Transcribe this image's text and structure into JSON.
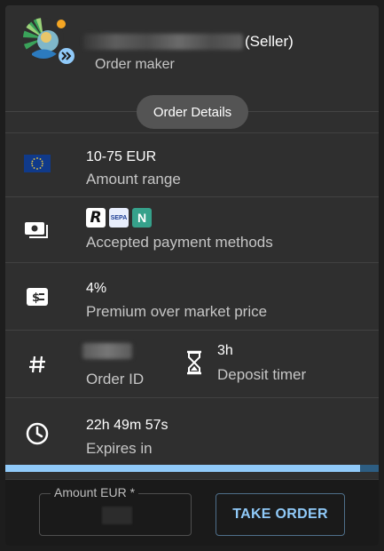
{
  "maker": {
    "seller_tag": "(Seller)",
    "role_label": "Order maker"
  },
  "section_chip": "Order Details",
  "amount": {
    "value": "10-75 EUR",
    "label": "Amount range"
  },
  "payment": {
    "label": "Accepted payment methods",
    "methods": [
      "R",
      "SEPA",
      "N"
    ]
  },
  "premium": {
    "value": "4%",
    "label": "Premium over market price"
  },
  "order_id": {
    "label": "Order ID"
  },
  "deposit": {
    "value": "3h",
    "label": "Deposit timer"
  },
  "expires": {
    "value": "22h 49m 57s",
    "label": "Expires in"
  },
  "progress_fraction": 0.95,
  "footer": {
    "amount_label": "Amount EUR *",
    "take_order_label": "TAKE ORDER"
  },
  "colors": {
    "accent": "#90caf9",
    "online": "#f5a623",
    "panel": "#2f2f2f"
  },
  "icons": {
    "amount": "eu-flag-icon",
    "payment": "cash-icon",
    "premium": "price-tag-icon",
    "order_id": "hash-icon",
    "deposit": "hourglass-icon",
    "expires": "clock-icon",
    "seller_badge": "double-chevron-icon"
  }
}
